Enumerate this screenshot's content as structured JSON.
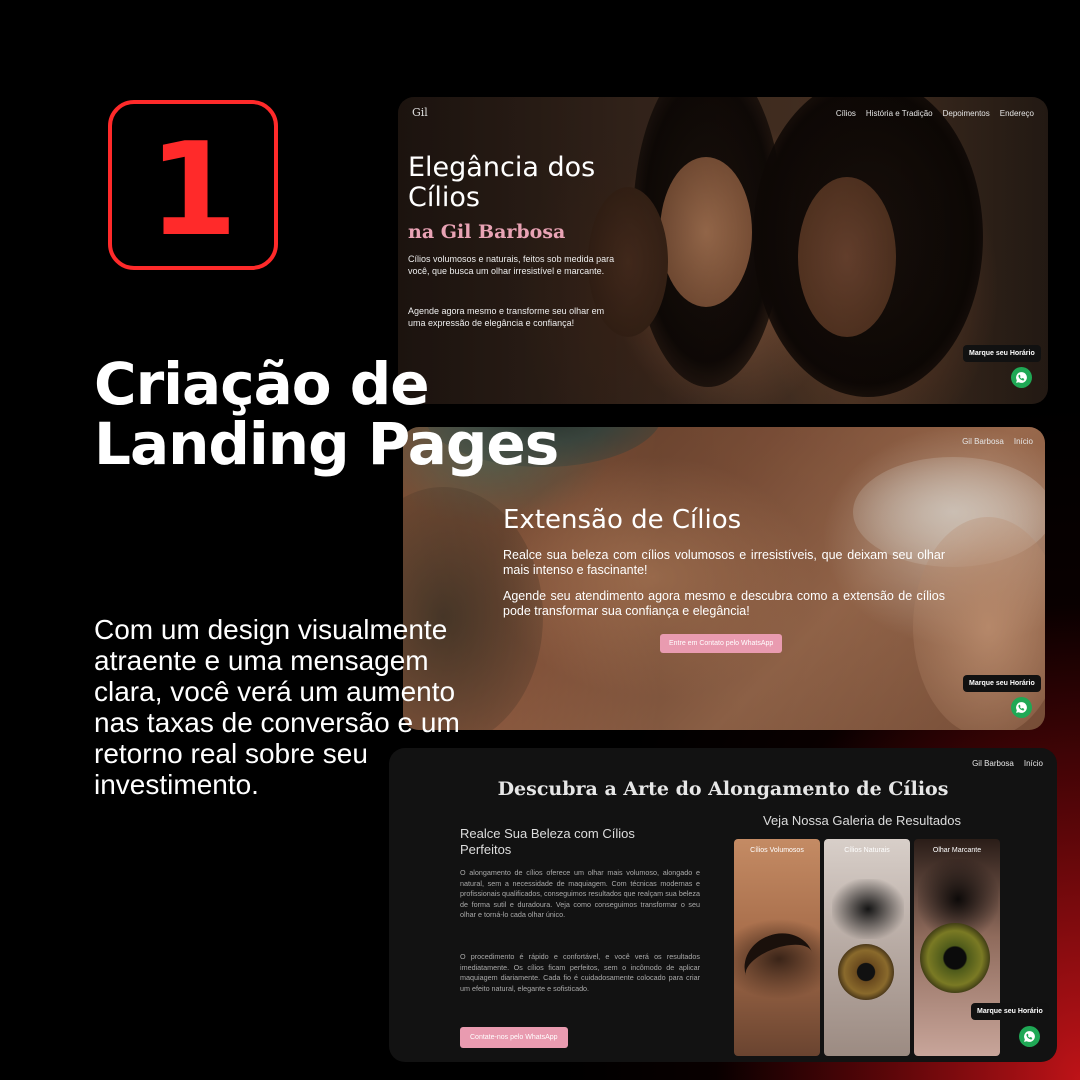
{
  "badge": {
    "number": "1"
  },
  "headline": "Criação de Landing Pages",
  "body": "Com um design visualmente atraente e uma mensagem clara, você verá um aumento nas taxas de conversão e um retorno real sobre seu investimento.",
  "colors": {
    "accent_red": "#ff2a2a",
    "pink": "#e99bb0",
    "whatsapp": "#1fa855"
  },
  "card1": {
    "logo": "Gil",
    "nav": [
      "Cílios",
      "História e Tradição",
      "Depoimentos",
      "Endereço"
    ],
    "title": "Elegância dos Cílios",
    "subtitle": "na Gil Barbosa",
    "text1": "Cílios volumosos e naturais, feitos sob medida para você, que busca um olhar irresistível e marcante.",
    "text2": "Agende agora mesmo e transforme seu olhar em uma expressão de elegância e confiança!",
    "cta": "Marque seu Horário",
    "whatsapp_icon": "whatsapp-icon"
  },
  "card2": {
    "nav": [
      "Gil Barbosa",
      "Início"
    ],
    "title": "Extensão de Cílios",
    "text1": "Realce sua beleza com cílios volumosos e irresistíveis, que deixam seu olhar mais intenso e fascinante!",
    "text2": "Agende seu atendimento agora mesmo e descubra como a extensão de cílios pode transformar sua confiança e elegância!",
    "button": "Entre em Contato pelo WhatsApp",
    "cta": "Marque seu Horário"
  },
  "card3": {
    "nav": [
      "Gil Barbosa",
      "Início"
    ],
    "title": "Descubra a Arte do Alongamento de Cílios",
    "heading": "Realce Sua Beleza com Cílios Perfeitos",
    "para1": "O alongamento de cílios oferece um olhar mais volumoso, alongado e natural, sem a necessidade de maquiagem. Com técnicas modernas e profissionais qualificados, conseguimos resultados que realçam sua beleza de forma sutil e duradoura. Veja como conseguimos transformar o seu olhar e torná-lo cada olhar único.",
    "para2": "O procedimento é rápido e confortável, e você verá os resultados imediatamente. Os cílios ficam perfeitos, sem o incômodo de aplicar maquiagem diariamente. Cada fio é cuidadosamente colocado para criar um efeito natural, elegante e sofisticado.",
    "button": "Contate-nos pelo WhatsApp",
    "gallery_title": "Veja Nossa Galeria de Resultados",
    "gallery": [
      "Cílios Volumosos",
      "Cílios Naturais",
      "Olhar Marcante"
    ],
    "cta": "Marque seu Horário"
  }
}
